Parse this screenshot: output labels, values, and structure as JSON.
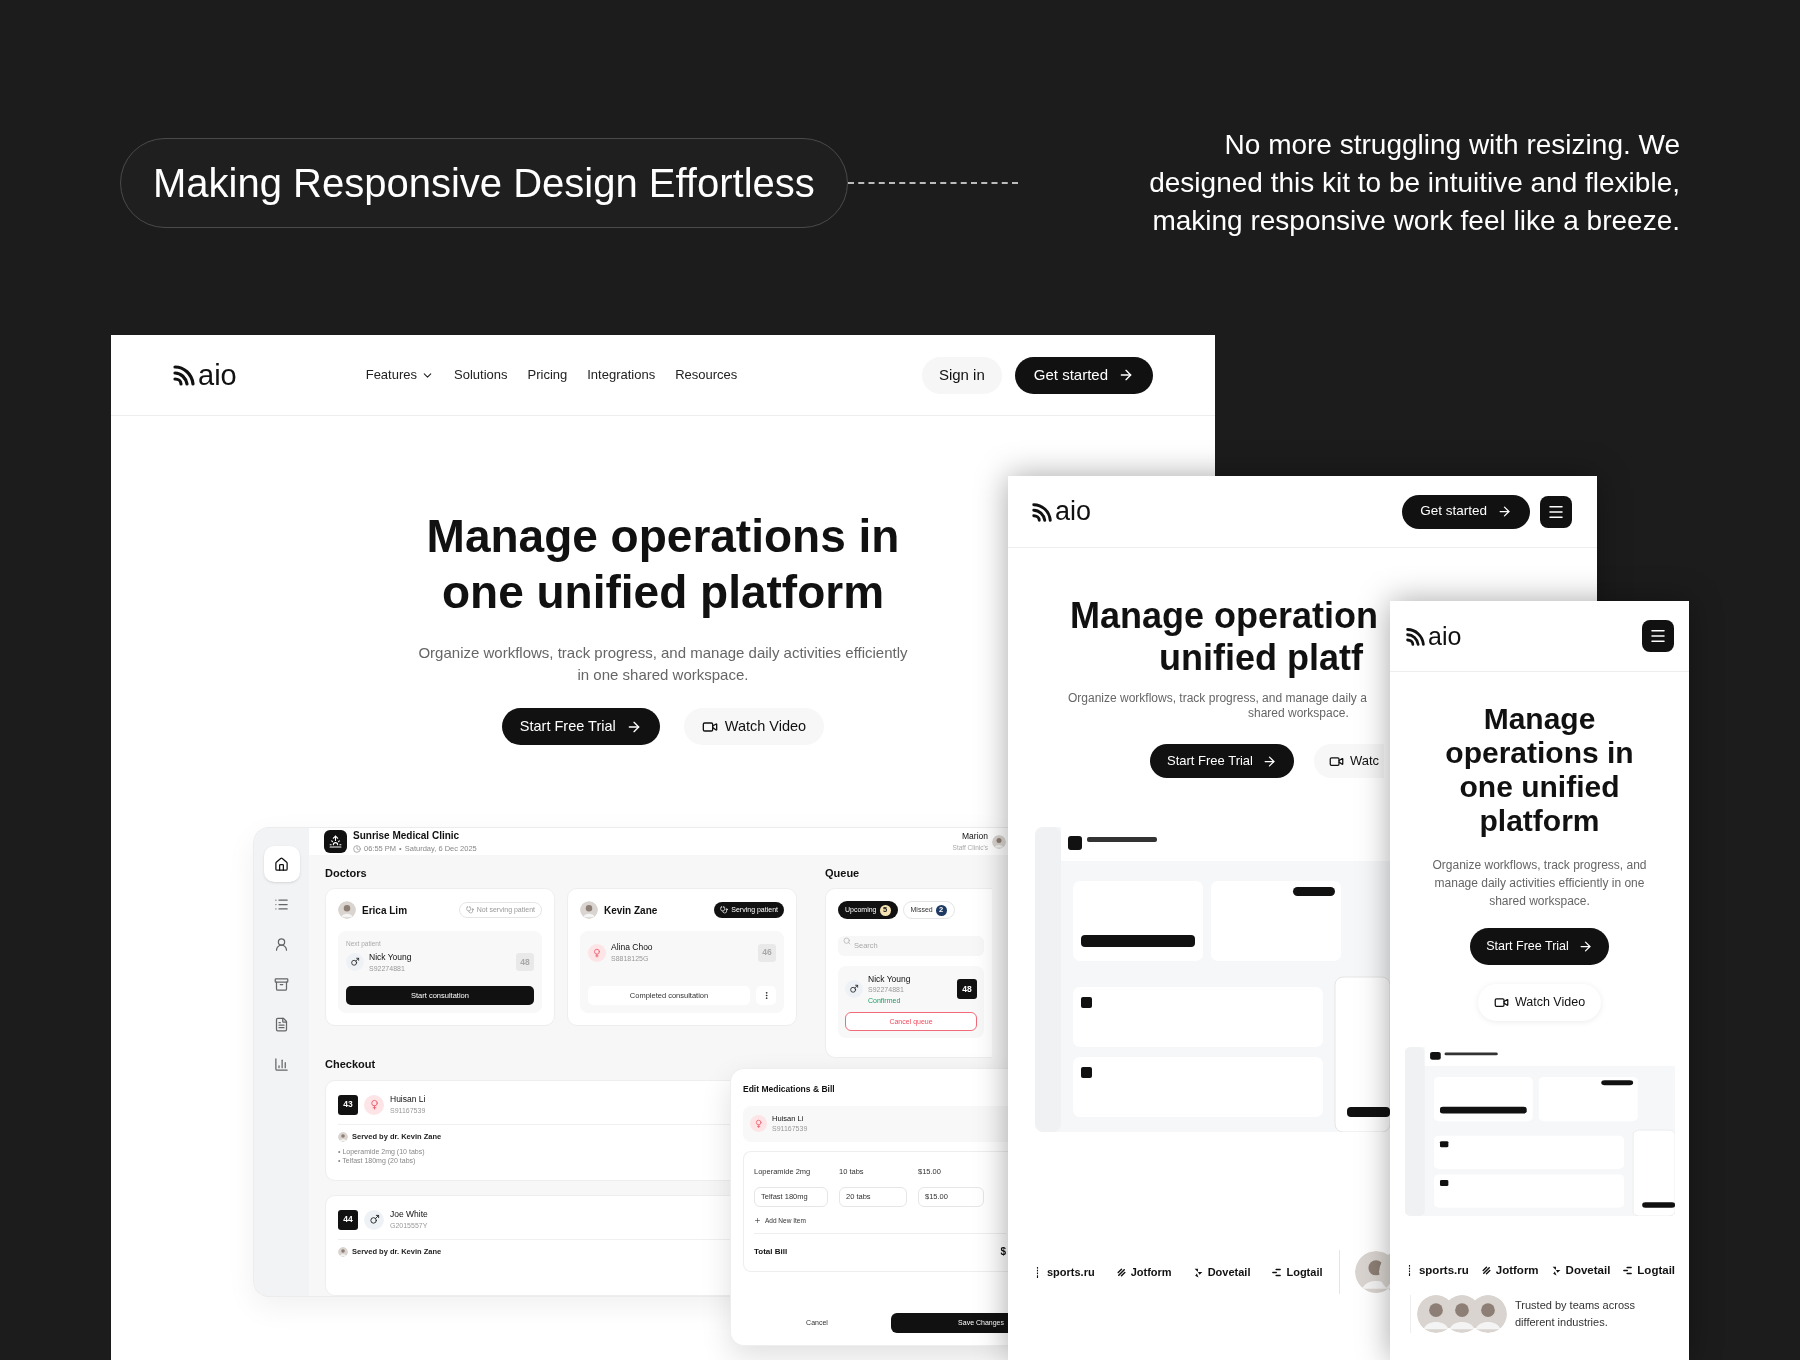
{
  "headline": "Making Responsive Design Effortless",
  "intro": "No more struggling with resizing. We\ndesigned this kit to be intuitive and flexible,\nmaking responsive work feel like a breeze.",
  "desktop": {
    "logo": "aio",
    "nav": [
      {
        "label": "Features",
        "has_menu": true
      },
      {
        "label": "Solutions",
        "has_menu": false
      },
      {
        "label": "Pricing",
        "has_menu": false
      },
      {
        "label": "Integrations",
        "has_menu": false
      },
      {
        "label": "Resources",
        "has_menu": false
      }
    ],
    "sign_in": "Sign in",
    "get_started": "Get started",
    "hero": {
      "title": "Manage operations in\none unified platform",
      "subtitle": "Organize workflows, track progress, and manage daily activities efficiently\nin one shared workspace.",
      "primary": "Start Free Trial",
      "secondary": "Watch Video"
    },
    "dashboard": {
      "clinic": {
        "name": "Sunrise Medical Clinic",
        "time": "06:55 PM",
        "separator": "•",
        "date": "Saturday, 6 Dec 2025"
      },
      "user": {
        "name": "Marion",
        "role": "Staff Clinic's"
      },
      "sidebar": [
        {
          "selected": true
        },
        {
          "selected": false
        },
        {
          "selected": false
        },
        {
          "selected": false
        },
        {
          "selected": false
        },
        {
          "selected": false
        }
      ],
      "doctors_title": "Doctors",
      "doctors": [
        {
          "name": "Erica Lim",
          "serving": false,
          "status": "Not serving patient",
          "patient_label": "Next patient",
          "patient": {
            "name": "Nick Young",
            "id": "S92274881",
            "kind": "male",
            "number": "48"
          },
          "action": "Start consultation"
        },
        {
          "name": "Kevin Zane",
          "serving": true,
          "status": "Serving patient",
          "patient": {
            "name": "Alina Choo",
            "id": "S8818125G",
            "kind": "female",
            "number": "46"
          },
          "action": "Completed consultation"
        }
      ],
      "queue": {
        "title": "Queue",
        "tabs": [
          {
            "label": "Upcoming",
            "count": "5",
            "selected": true,
            "color": "#f6e3b4"
          },
          {
            "label": "Missed",
            "count": "2",
            "selected": false,
            "color": "#1f3b63"
          }
        ],
        "search_placeholder": "Search",
        "item": {
          "name": "Nick Young",
          "id": "S92274881",
          "kind": "male",
          "status": "Confirmed",
          "number": "48"
        },
        "cancel": "Cancel queue"
      },
      "checkout_title": "Checkout",
      "checkout": [
        {
          "number": "43",
          "name": "Huisan Li",
          "id": "S91167539",
          "kind": "female",
          "served_by": "Served by dr. Kevin Zane",
          "items": [
            "• Loperamide 2mg (10 tabs)",
            "• Telfast 180mg (20 tabs)"
          ]
        },
        {
          "number": "44",
          "name": "Joe White",
          "id": "G2015557Y",
          "kind": "male",
          "served_by": "Served by dr. Kevin Zane"
        }
      ],
      "modal": {
        "title": "Edit Medications & Bill",
        "patient": {
          "name": "Huisan Li",
          "id": "S91167539",
          "kind": "female"
        },
        "lines": [
          {
            "kind": "text",
            "name": "Loperamide 2mg",
            "qty": "10 tabs",
            "price": "$15.00"
          },
          {
            "kind": "input",
            "name": "Telfast 180mg",
            "qty": "20 tabs",
            "price": "$15.00"
          }
        ],
        "add": "Add New Item",
        "total_label": "Total Bill",
        "total": "$",
        "cancel": "Cancel",
        "save": "Save Changes"
      }
    }
  },
  "tablet": {
    "logo": "aio",
    "get_started": "Get started",
    "hero": {
      "title_lines": [
        "Manage operation",
        "unified platf"
      ],
      "subtitle_lines": [
        "Organize workflows, track progress, and manage daily a",
        "shared workspace."
      ],
      "primary": "Start Free Trial",
      "secondary": "Watc"
    },
    "logos": [
      {
        "name": "sports.ru",
        "kind": "dots"
      },
      {
        "name": "Jotform",
        "kind": "slashes"
      },
      {
        "name": "Dovetail",
        "kind": "arrows"
      },
      {
        "name": "Logtail",
        "kind": "bars"
      }
    ]
  },
  "mobile": {
    "logo": "aio",
    "hero": {
      "title": "Manage\noperations in\none unified\nplatform",
      "subtitle": "Organize workflows, track progress, and\nmanage daily activities efficiently in one\nshared workspace.",
      "primary": "Start Free Trial",
      "secondary": "Watch Video"
    },
    "logos": [
      {
        "name": "sports.ru",
        "kind": "dots"
      },
      {
        "name": "Jotform",
        "kind": "slashes"
      },
      {
        "name": "Dovetail",
        "kind": "arrows"
      },
      {
        "name": "Logtail",
        "kind": "bars"
      }
    ],
    "trusted": "Trusted by teams across\ndifferent industries."
  }
}
